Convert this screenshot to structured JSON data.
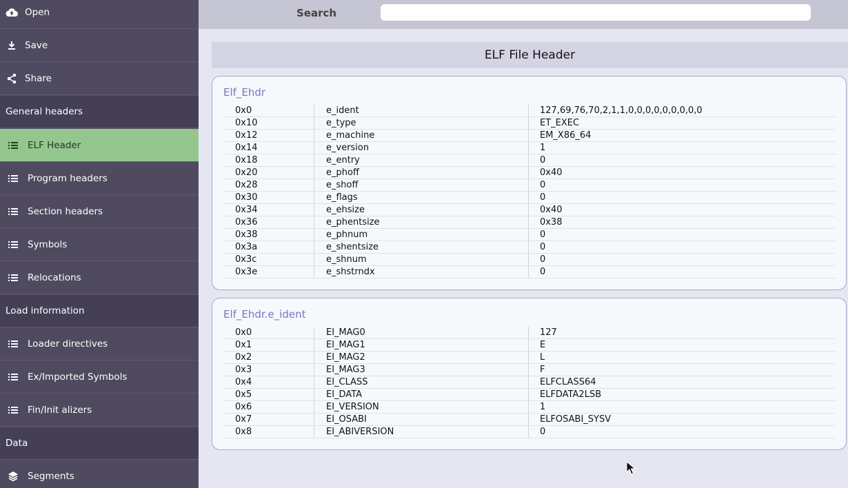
{
  "sidebar": {
    "items": [
      {
        "label": "Open",
        "icon": "cloud-upload-icon",
        "kind": "action"
      },
      {
        "label": "Save",
        "icon": "download-icon",
        "kind": "action"
      },
      {
        "label": "Share",
        "icon": "share-icon",
        "kind": "action"
      },
      {
        "label": "General headers",
        "kind": "section"
      },
      {
        "label": "ELF Header",
        "icon": "list-icon",
        "kind": "sub",
        "active": true
      },
      {
        "label": "Program headers",
        "icon": "list-icon",
        "kind": "sub"
      },
      {
        "label": "Section headers",
        "icon": "list-icon",
        "kind": "sub"
      },
      {
        "label": "Symbols",
        "icon": "list-icon",
        "kind": "sub"
      },
      {
        "label": "Relocations",
        "icon": "list-icon",
        "kind": "sub"
      },
      {
        "label": "Load information",
        "kind": "section"
      },
      {
        "label": "Loader directives",
        "icon": "list-icon",
        "kind": "sub"
      },
      {
        "label": "Ex/Imported Symbols",
        "icon": "list-icon",
        "kind": "sub"
      },
      {
        "label": "Fin/Init alizers",
        "icon": "list-icon",
        "kind": "sub"
      },
      {
        "label": "Data",
        "kind": "section"
      },
      {
        "label": "Segments",
        "icon": "layers-icon",
        "kind": "sub"
      }
    ]
  },
  "search": {
    "label": "Search",
    "value": ""
  },
  "main": {
    "title": "ELF File Header"
  },
  "tables": [
    {
      "title": "Elf_Ehdr",
      "rows": [
        [
          "0x0",
          "e_ident",
          "127,69,76,70,2,1,1,0,0,0,0,0,0,0,0,0"
        ],
        [
          "0x10",
          "e_type",
          "ET_EXEC"
        ],
        [
          "0x12",
          "e_machine",
          "EM_X86_64"
        ],
        [
          "0x14",
          "e_version",
          "1"
        ],
        [
          "0x18",
          "e_entry",
          "0"
        ],
        [
          "0x20",
          "e_phoff",
          "0x40"
        ],
        [
          "0x28",
          "e_shoff",
          "0"
        ],
        [
          "0x30",
          "e_flags",
          "0"
        ],
        [
          "0x34",
          "e_ehsize",
          "0x40"
        ],
        [
          "0x36",
          "e_phentsize",
          "0x38"
        ],
        [
          "0x38",
          "e_phnum",
          "0"
        ],
        [
          "0x3a",
          "e_shentsize",
          "0"
        ],
        [
          "0x3c",
          "e_shnum",
          "0"
        ],
        [
          "0x3e",
          "e_shstrndx",
          "0"
        ]
      ]
    },
    {
      "title": "Elf_Ehdr.e_ident",
      "rows": [
        [
          "0x0",
          "EI_MAG0",
          "127"
        ],
        [
          "0x1",
          "EI_MAG1",
          "E"
        ],
        [
          "0x2",
          "EI_MAG2",
          "L"
        ],
        [
          "0x3",
          "EI_MAG3",
          "F"
        ],
        [
          "0x4",
          "EI_CLASS",
          "ELFCLASS64"
        ],
        [
          "0x5",
          "EI_DATA",
          "ELFDATA2LSB"
        ],
        [
          "0x6",
          "EI_VERSION",
          "1"
        ],
        [
          "0x7",
          "EI_OSABI",
          "ELFOSABI_SYSV"
        ],
        [
          "0x8",
          "EI_ABIVERSION",
          "0"
        ]
      ]
    }
  ],
  "colors": {
    "sidebar": "#4f4a5f",
    "section": "#443f55",
    "active": "#94c68e",
    "accent": "#7f72c0"
  }
}
